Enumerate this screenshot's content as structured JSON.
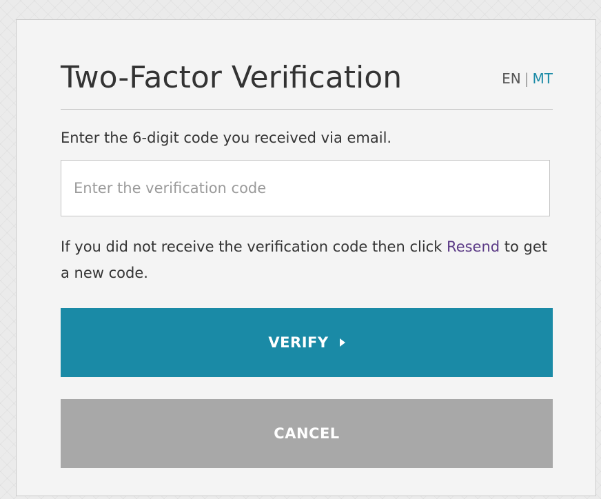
{
  "dialog": {
    "title": "Two-Factor Verification",
    "languages": {
      "en": "EN",
      "separator": "|",
      "mt": "MT"
    },
    "instruction": "Enter the 6-digit code you received via email.",
    "code_input": {
      "value": "",
      "placeholder": "Enter the verification code"
    },
    "resend": {
      "prefix": "If you did not receive the verification code then click ",
      "link_label": "Resend",
      "suffix": " to get a new code."
    },
    "verify_label": "VERIFY",
    "verify_icon": "play-arrow-icon",
    "cancel_label": "CANCEL"
  },
  "colors": {
    "accent": "#1a8aa6",
    "cancel": "#a8a8a8",
    "link": "#5b3a86",
    "panel": "#f4f4f4"
  }
}
